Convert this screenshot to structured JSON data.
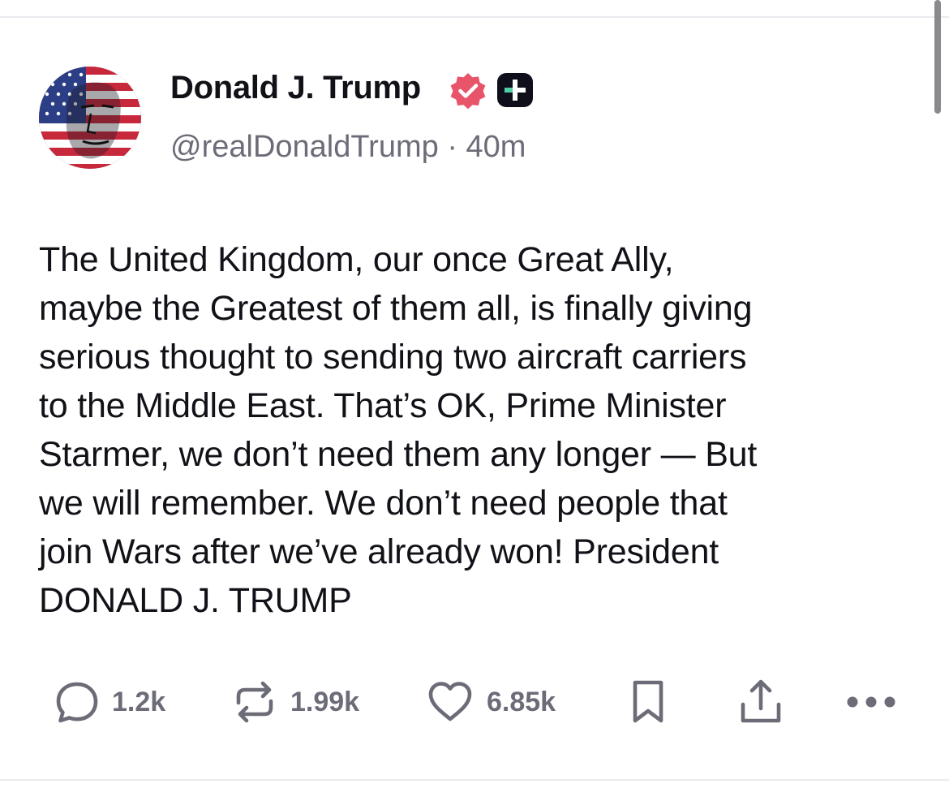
{
  "author": {
    "display_name": "Donald J. Trump",
    "handle": "@realDonaldTrump",
    "separator": "·",
    "time_ago": "40m"
  },
  "post": {
    "lines": [
      "The United Kingdom, our once Great Ally,",
      "maybe the Greatest of them all, is finally giving",
      "serious thought to sending two aircraft carriers",
      "to the Middle East. That’s OK, Prime Minister",
      "Starmer, we don’t need them any longer — But",
      "we will remember. We don’t need people that",
      "join Wars after we’ve already won! President",
      "DONALD J. TRUMP"
    ]
  },
  "actions": {
    "reply_count": "1.2k",
    "retruth_count": "1.99k",
    "like_count": "6.85k"
  },
  "icons": {
    "verified": "verified-badge-icon",
    "plus": "plus-subscriber-icon",
    "reply": "speech-bubble-icon",
    "retruth": "repost-arrows-icon",
    "like": "heart-icon",
    "bookmark": "bookmark-icon",
    "share": "share-upload-icon",
    "more": "ellipsis-icon"
  },
  "colors": {
    "verified": "#e8546a",
    "text": "#111118",
    "muted": "#6c6c78",
    "divider": "#ebebef"
  }
}
